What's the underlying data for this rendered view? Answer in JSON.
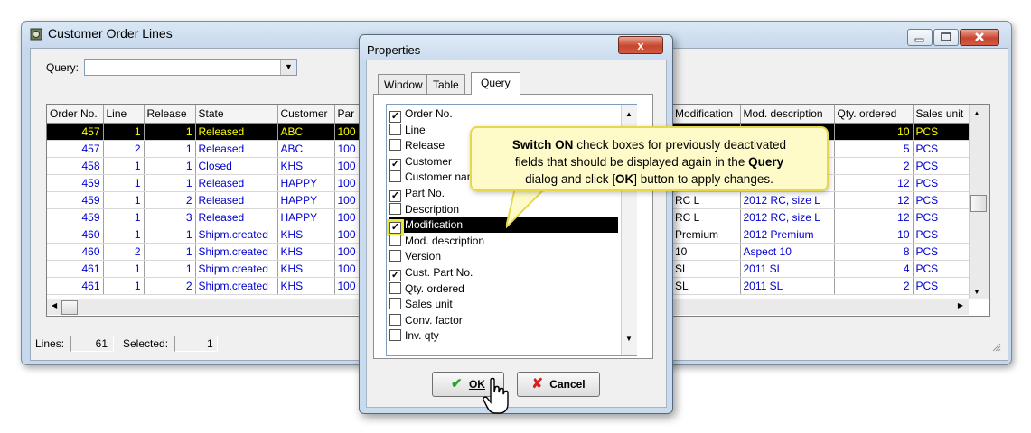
{
  "main_window": {
    "title": "Customer Order Lines",
    "query_label": "Query:",
    "query_value": "",
    "columns_left": [
      "Order No.",
      "Line",
      "Release",
      "State",
      "Customer",
      "Par"
    ],
    "columns_right": [
      "Modification",
      "Mod. description",
      "Qty. ordered",
      "Sales unit"
    ],
    "rows": [
      {
        "order": "457",
        "line": "1",
        "release": "1",
        "state": "Released",
        "customer": "ABC",
        "part": "100",
        "modification": "",
        "mod_desc": "",
        "qty": "10",
        "unit": "PCS"
      },
      {
        "order": "457",
        "line": "2",
        "release": "1",
        "state": "Released",
        "customer": "ABC",
        "part": "100",
        "modification": "",
        "mod_desc": "",
        "qty": "5",
        "unit": "PCS"
      },
      {
        "order": "458",
        "line": "1",
        "release": "1",
        "state": "Closed",
        "customer": "KHS",
        "part": "100",
        "modification": "",
        "mod_desc": "",
        "qty": "2",
        "unit": "PCS"
      },
      {
        "order": "459",
        "line": "1",
        "release": "1",
        "state": "Released",
        "customer": "HAPPY",
        "part": "100",
        "modification": "",
        "mod_desc": "",
        "qty": "12",
        "unit": "PCS"
      },
      {
        "order": "459",
        "line": "1",
        "release": "2",
        "state": "Released",
        "customer": "HAPPY",
        "part": "100",
        "modification": "RC L",
        "mod_desc": "2012 RC, size L",
        "qty": "12",
        "unit": "PCS"
      },
      {
        "order": "459",
        "line": "1",
        "release": "3",
        "state": "Released",
        "customer": "HAPPY",
        "part": "100",
        "modification": "RC L",
        "mod_desc": "2012 RC, size L",
        "qty": "12",
        "unit": "PCS"
      },
      {
        "order": "460",
        "line": "1",
        "release": "1",
        "state": "Shipm.created",
        "customer": "KHS",
        "part": "100",
        "modification": "Premium",
        "mod_desc": "2012 Premium",
        "qty": "10",
        "unit": "PCS"
      },
      {
        "order": "460",
        "line": "2",
        "release": "1",
        "state": "Shipm.created",
        "customer": "KHS",
        "part": "100",
        "modification": "10",
        "mod_desc": "Aspect 10",
        "qty": "8",
        "unit": "PCS"
      },
      {
        "order": "461",
        "line": "1",
        "release": "1",
        "state": "Shipm.created",
        "customer": "KHS",
        "part": "100",
        "modification": "SL",
        "mod_desc": "2011 SL",
        "qty": "4",
        "unit": "PCS"
      },
      {
        "order": "461",
        "line": "1",
        "release": "2",
        "state": "Shipm.created",
        "customer": "KHS",
        "part": "100",
        "modification": "SL",
        "mod_desc": "2011 SL",
        "qty": "2",
        "unit": "PCS"
      }
    ],
    "status": {
      "lines_label": "Lines:",
      "lines_value": "61",
      "selected_label": "Selected:",
      "selected_value": "1"
    }
  },
  "dialog": {
    "title": "Properties",
    "close_label": "x",
    "tabs": [
      "Window",
      "Table",
      "Query"
    ],
    "active_tab": "Query",
    "fields": [
      {
        "label": "Order No.",
        "checked": true
      },
      {
        "label": "Line",
        "checked": false
      },
      {
        "label": "Release",
        "checked": false
      },
      {
        "label": "Customer",
        "checked": true
      },
      {
        "label": "Customer nam",
        "checked": false
      },
      {
        "label": "Part No.",
        "checked": true
      },
      {
        "label": "Description",
        "checked": false
      },
      {
        "label": "Modification",
        "checked": true,
        "highlighted": true
      },
      {
        "label": "Mod. description",
        "checked": false
      },
      {
        "label": "Version",
        "checked": false
      },
      {
        "label": "Cust. Part No.",
        "checked": true
      },
      {
        "label": "Qty. ordered",
        "checked": false
      },
      {
        "label": "Sales unit",
        "checked": false
      },
      {
        "label": "Conv. factor",
        "checked": false
      },
      {
        "label": "Inv. qty",
        "checked": false
      }
    ],
    "ok_label": "OK",
    "cancel_label": "Cancel"
  },
  "callout": {
    "p1": "Switch ON",
    "p2": " check boxes for previously deactivated",
    "p3": "fields that should be displayed again in the ",
    "p4": "Query",
    "p5": "dialog and click [",
    "p6": "OK",
    "p7": "] button to apply changes."
  },
  "colors": {
    "selected_row_bg": "#000000",
    "selected_row_text": "#ffff00",
    "data_text": "#0000d0",
    "callout_bg": "#fffbc8",
    "callout_border": "#e6d84a"
  },
  "icons": [
    "app-icon",
    "minimize-icon",
    "maximize-icon",
    "close-icon",
    "dropdown-arrow-icon",
    "checkmark-icon",
    "cancel-x-icon",
    "hand-cursor-icon",
    "resize-grip-icon"
  ]
}
